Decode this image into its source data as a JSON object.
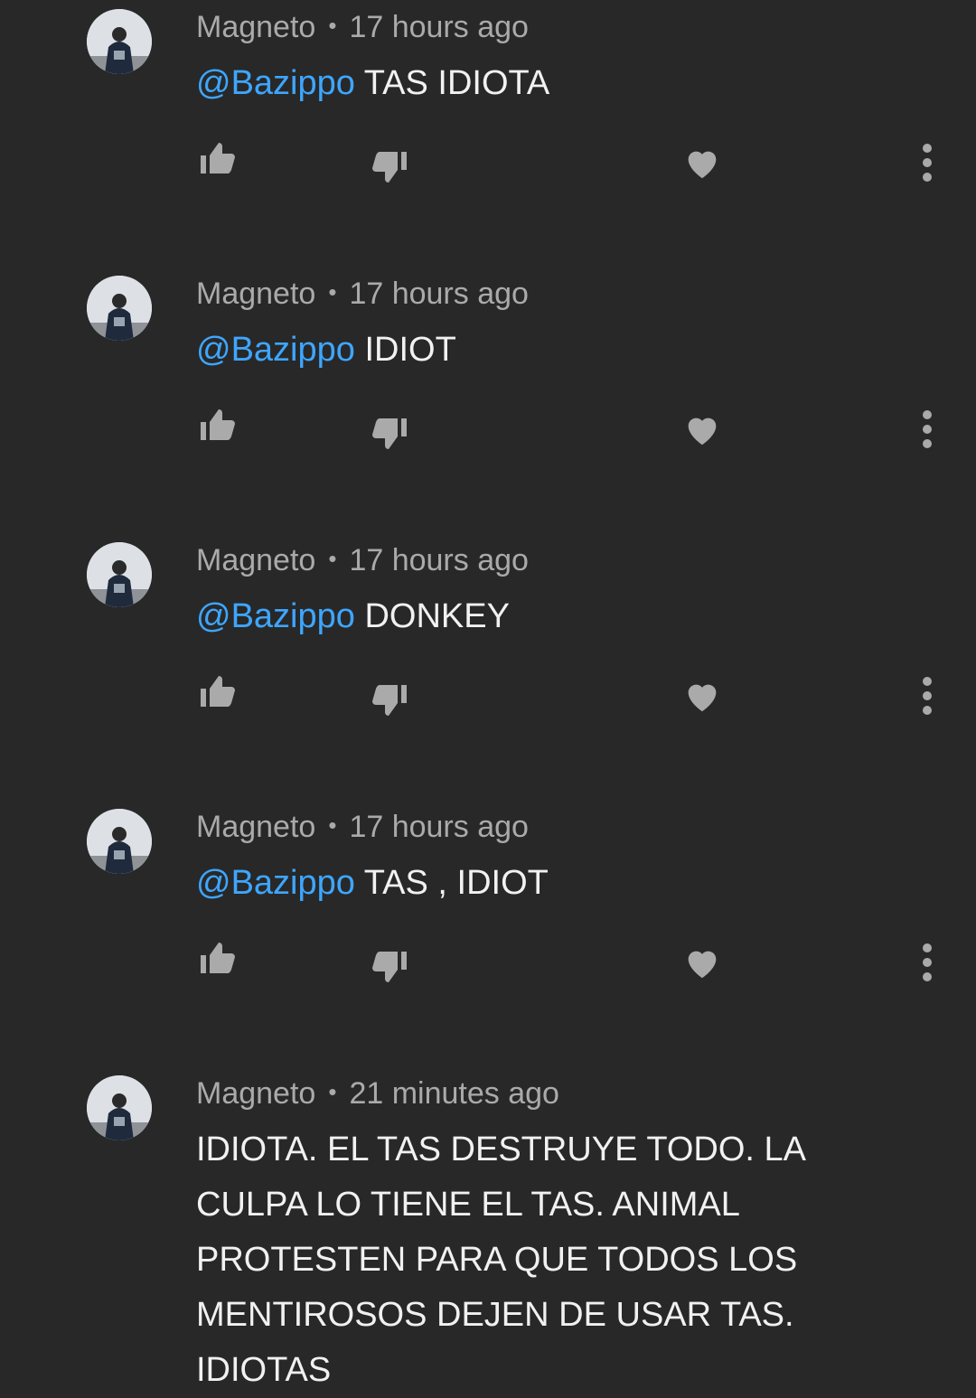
{
  "comments": [
    {
      "author": "Magneto",
      "separator": "•",
      "time": "17 hours ago",
      "mention": "@Bazippo",
      "text": " TAS IDIOTA"
    },
    {
      "author": "Magneto",
      "separator": "•",
      "time": "17 hours ago",
      "mention": "@Bazippo",
      "text": " IDIOT"
    },
    {
      "author": "Magneto",
      "separator": "•",
      "time": "17 hours ago",
      "mention": "@Bazippo",
      "text": " DONKEY"
    },
    {
      "author": "Magneto",
      "separator": "•",
      "time": "17 hours ago",
      "mention": "@Bazippo",
      "text": " TAS , IDIOT"
    },
    {
      "author": "Magneto",
      "separator": "•",
      "time": "21 minutes ago",
      "mention": "",
      "text": "IDIOTA. EL TAS DESTRUYE TODO. LA CULPA LO TIENE EL TAS. ANIMAL PROTESTEN PARA QUE TODOS LOS MENTIROSOS DEJEN DE USAR TAS. IDIOTAS"
    }
  ],
  "icons": {
    "like": "thumbs-up-icon",
    "dislike": "thumbs-down-icon",
    "heart": "heart-icon",
    "more": "more-vert-icon"
  },
  "colors": {
    "background": "#282828",
    "meta": "#aaaaaa",
    "text": "#f1f1f1",
    "mention": "#3ea6ff",
    "icon": "#aaaaaa"
  }
}
